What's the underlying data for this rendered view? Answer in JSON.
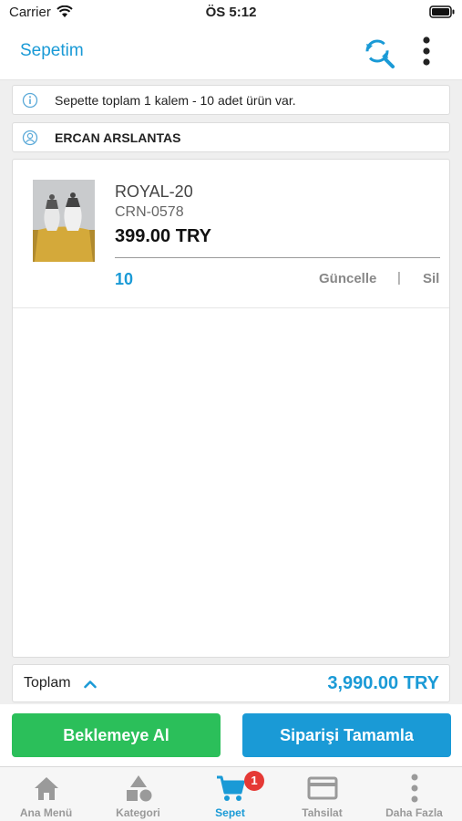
{
  "status_bar": {
    "carrier": "Carrier",
    "time": "ÖS 5:12"
  },
  "header": {
    "title": "Sepetim",
    "refresh_icon": "refresh-search-icon",
    "more_icon": "more-vertical-icon"
  },
  "summary": {
    "text": "Sepette toplam 1 kalem - 10 adet ürün var.",
    "icon": "info-icon"
  },
  "customer": {
    "name": "ERCAN ARSLANTAS",
    "icon": "customer-icon"
  },
  "cart": {
    "items": [
      {
        "name": "ROYAL-20",
        "code": "CRN-0578",
        "price": "399.00 TRY",
        "quantity": "10",
        "update_label": "Güncelle",
        "separator": "|",
        "delete_label": "Sil"
      }
    ]
  },
  "total": {
    "label": "Toplam",
    "value": "3,990.00 TRY"
  },
  "actions": {
    "hold_label": "Beklemeye Al",
    "complete_label": "Siparişi Tamamla"
  },
  "tab_bar": {
    "tabs": [
      {
        "label": "Ana Menü",
        "icon": "home-icon"
      },
      {
        "label": "Kategori",
        "icon": "category-icon"
      },
      {
        "label": "Sepet",
        "icon": "cart-icon",
        "badge": "1"
      },
      {
        "label": "Tahsilat",
        "icon": "credit-card-icon"
      },
      {
        "label": "Daha Fazla",
        "icon": "more-icon"
      }
    ]
  },
  "colors": {
    "accent": "#1a9ad6",
    "hold_button": "#2bbf5a",
    "badge": "#e53935"
  }
}
